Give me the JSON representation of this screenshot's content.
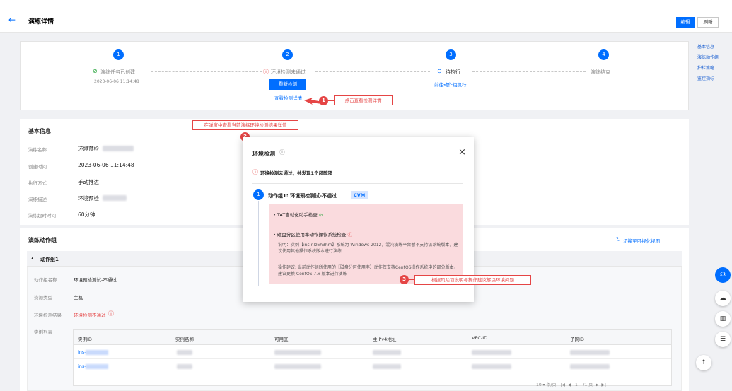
{
  "header": {
    "back_icon": "←",
    "title": "演练详情",
    "edit_label": "编辑",
    "refresh_label": "刷新"
  },
  "steps": [
    {
      "num": "1",
      "status": "演练任务已创建",
      "sub": "2023-06-06 11:14:48"
    },
    {
      "num": "2",
      "status": "环境检测未通过",
      "button": "重新检测",
      "link": "查看检测详情"
    },
    {
      "num": "3",
      "status": "待执行",
      "link": "前往动作组执行"
    },
    {
      "num": "4",
      "status": "演练结束"
    }
  ],
  "anchors": [
    "基本信息",
    "演练动作组",
    "护栏策略",
    "监控指标"
  ],
  "annotations": {
    "a1_num": "1",
    "a1_text": "点击查看检测详情",
    "a2_num": "2",
    "a2_text": "在弹窗中查看当前演练环境检测结果详情",
    "a3_num": "3",
    "a3_text": "根据风险项说明与操作建议解决环境问题"
  },
  "basic": {
    "title": "基本信息",
    "rows": [
      {
        "label": "演练名称",
        "value": "环境预检"
      },
      {
        "label": "创建时间",
        "value": "2023-06-06 11:14:48"
      },
      {
        "label": "执行方式",
        "value": "手动推进"
      },
      {
        "label": "演练描述",
        "value": "环境预检"
      },
      {
        "label": "演练超时时间",
        "value": "60分钟"
      }
    ]
  },
  "action_group": {
    "title": "演练动作组",
    "switch_label": "切换至可视化视图",
    "group_name": "动作组1",
    "rows": [
      {
        "label": "动作组名称",
        "value": "环境预检测试-不通过"
      },
      {
        "label": "资源类型",
        "value": "主机"
      },
      {
        "label": "环境检测结果",
        "value": "环境检测不通过"
      },
      {
        "label": "实例列表",
        "value": ""
      }
    ],
    "table_headers": [
      "实例ID",
      "实例名称",
      "可用区",
      "主IPv4地址",
      "VPC-ID",
      "子网ID"
    ],
    "instance_prefix": "ins-",
    "pagination": "10 ▾ 条/页   |◀  ◀   1    /1 页  ▶  ▶|"
  },
  "modal": {
    "title": "环境检测",
    "info_icon": "ⓘ",
    "close_icon": "×",
    "error_summary": "环境检测未通过，共发现1个风险项",
    "group_num": "1",
    "group_title": "动作组1: 环境预检测试-不通过",
    "group_tag": "CVM",
    "check1": "TAT自动化助手检查",
    "check2": "磁盘分区使用率动作操作系统检查",
    "desc": "说明：实例【ins-nlz6h3hm】系统为 Windows 2012，混沌演练平台暂不支持该系统版本，建议使用其他操作系统版本进行演练",
    "suggest": "操作建议: 当前动作组所使用的【磁盘分区使用率】动作仅支持CentOS操作系统中的部分版本，建议更换 CentOS 7.x 版本进行演练"
  },
  "colors": {
    "primary": "#006eff",
    "danger": "#e54545",
    "pink": "#fadbde"
  }
}
